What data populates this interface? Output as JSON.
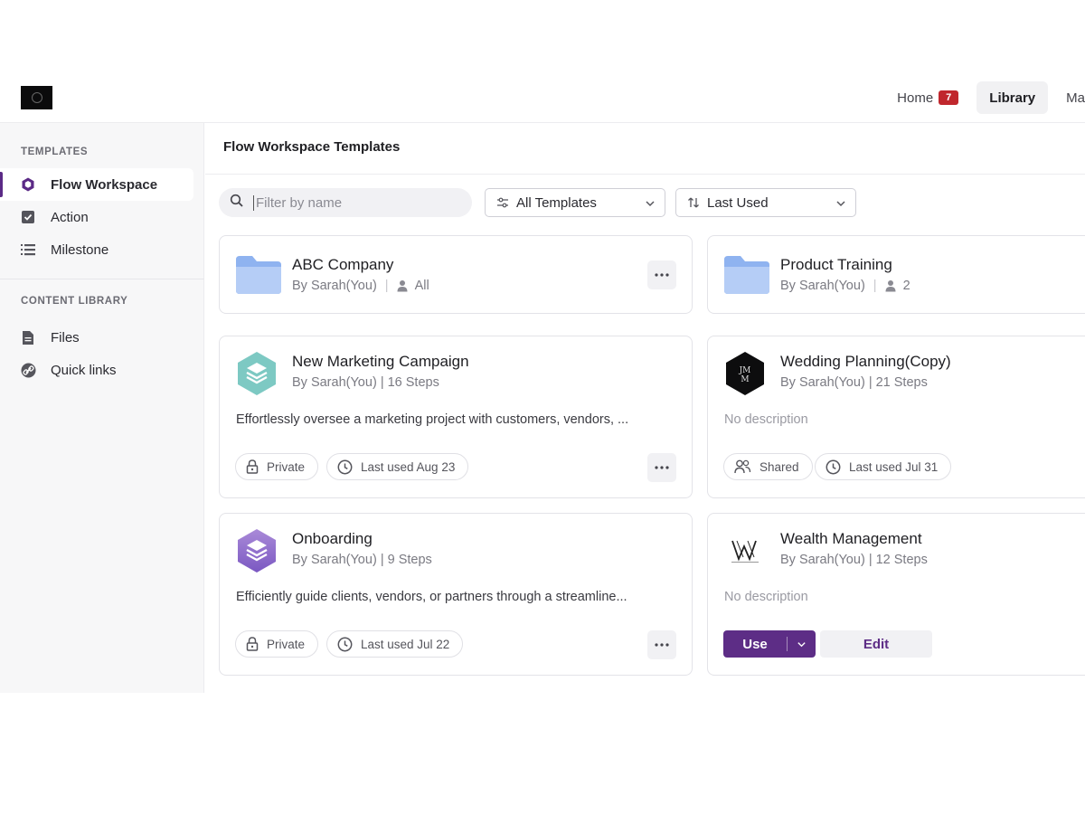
{
  "header": {
    "nav": [
      {
        "label": "Home",
        "badge": "7"
      },
      {
        "label": "Library"
      },
      {
        "label": "Ma"
      }
    ]
  },
  "sidebar": {
    "templates_heading": "TEMPLATES",
    "templates_items": [
      {
        "label": "Flow Workspace",
        "icon": "hexagon-icon",
        "active": true
      },
      {
        "label": "Action",
        "icon": "checkbox-icon"
      },
      {
        "label": "Milestone",
        "icon": "list-icon"
      }
    ],
    "content_heading": "CONTENT LIBRARY",
    "content_items": [
      {
        "label": "Files",
        "icon": "file-icon"
      },
      {
        "label": "Quick links",
        "icon": "link-icon"
      }
    ]
  },
  "main": {
    "title": "Flow Workspace Templates",
    "search_placeholder": "Filter by name",
    "filter_select": "All Templates",
    "sort_select": "Last Used"
  },
  "folders": [
    {
      "title": "ABC Company",
      "author": "By Sarah(You)",
      "members": "All"
    },
    {
      "title": "Product Training",
      "author": "By Sarah(You)",
      "members": "2"
    }
  ],
  "templates": [
    {
      "title": "New Marketing Campaign",
      "author": "By Sarah(You)",
      "steps": "| 16 Steps",
      "description": "Effortlessly oversee a marketing project with customers, vendors, ...",
      "visibility": "Private",
      "last_used": "Last used Aug 23"
    },
    {
      "title": "Wedding Planning(Copy)",
      "author": "By Sarah(You)",
      "steps": "| 21 Steps",
      "description": "No description",
      "visibility": "Shared",
      "last_used": "Last used Jul 31"
    },
    {
      "title": "Onboarding",
      "author": "By Sarah(You)",
      "steps": "| 9 Steps",
      "description": "Efficiently guide clients, vendors, or partners through a streamline...",
      "visibility": "Private",
      "last_used": "Last used Jul 22"
    },
    {
      "title": "Wealth Management",
      "author": "By Sarah(You)",
      "steps": "| 12 Steps",
      "description": "No description",
      "use_label": "Use",
      "edit_label": "Edit"
    }
  ],
  "colors": {
    "accent": "#5d2d86",
    "badge": "#c0272d",
    "folder": "#8fb3f0"
  }
}
